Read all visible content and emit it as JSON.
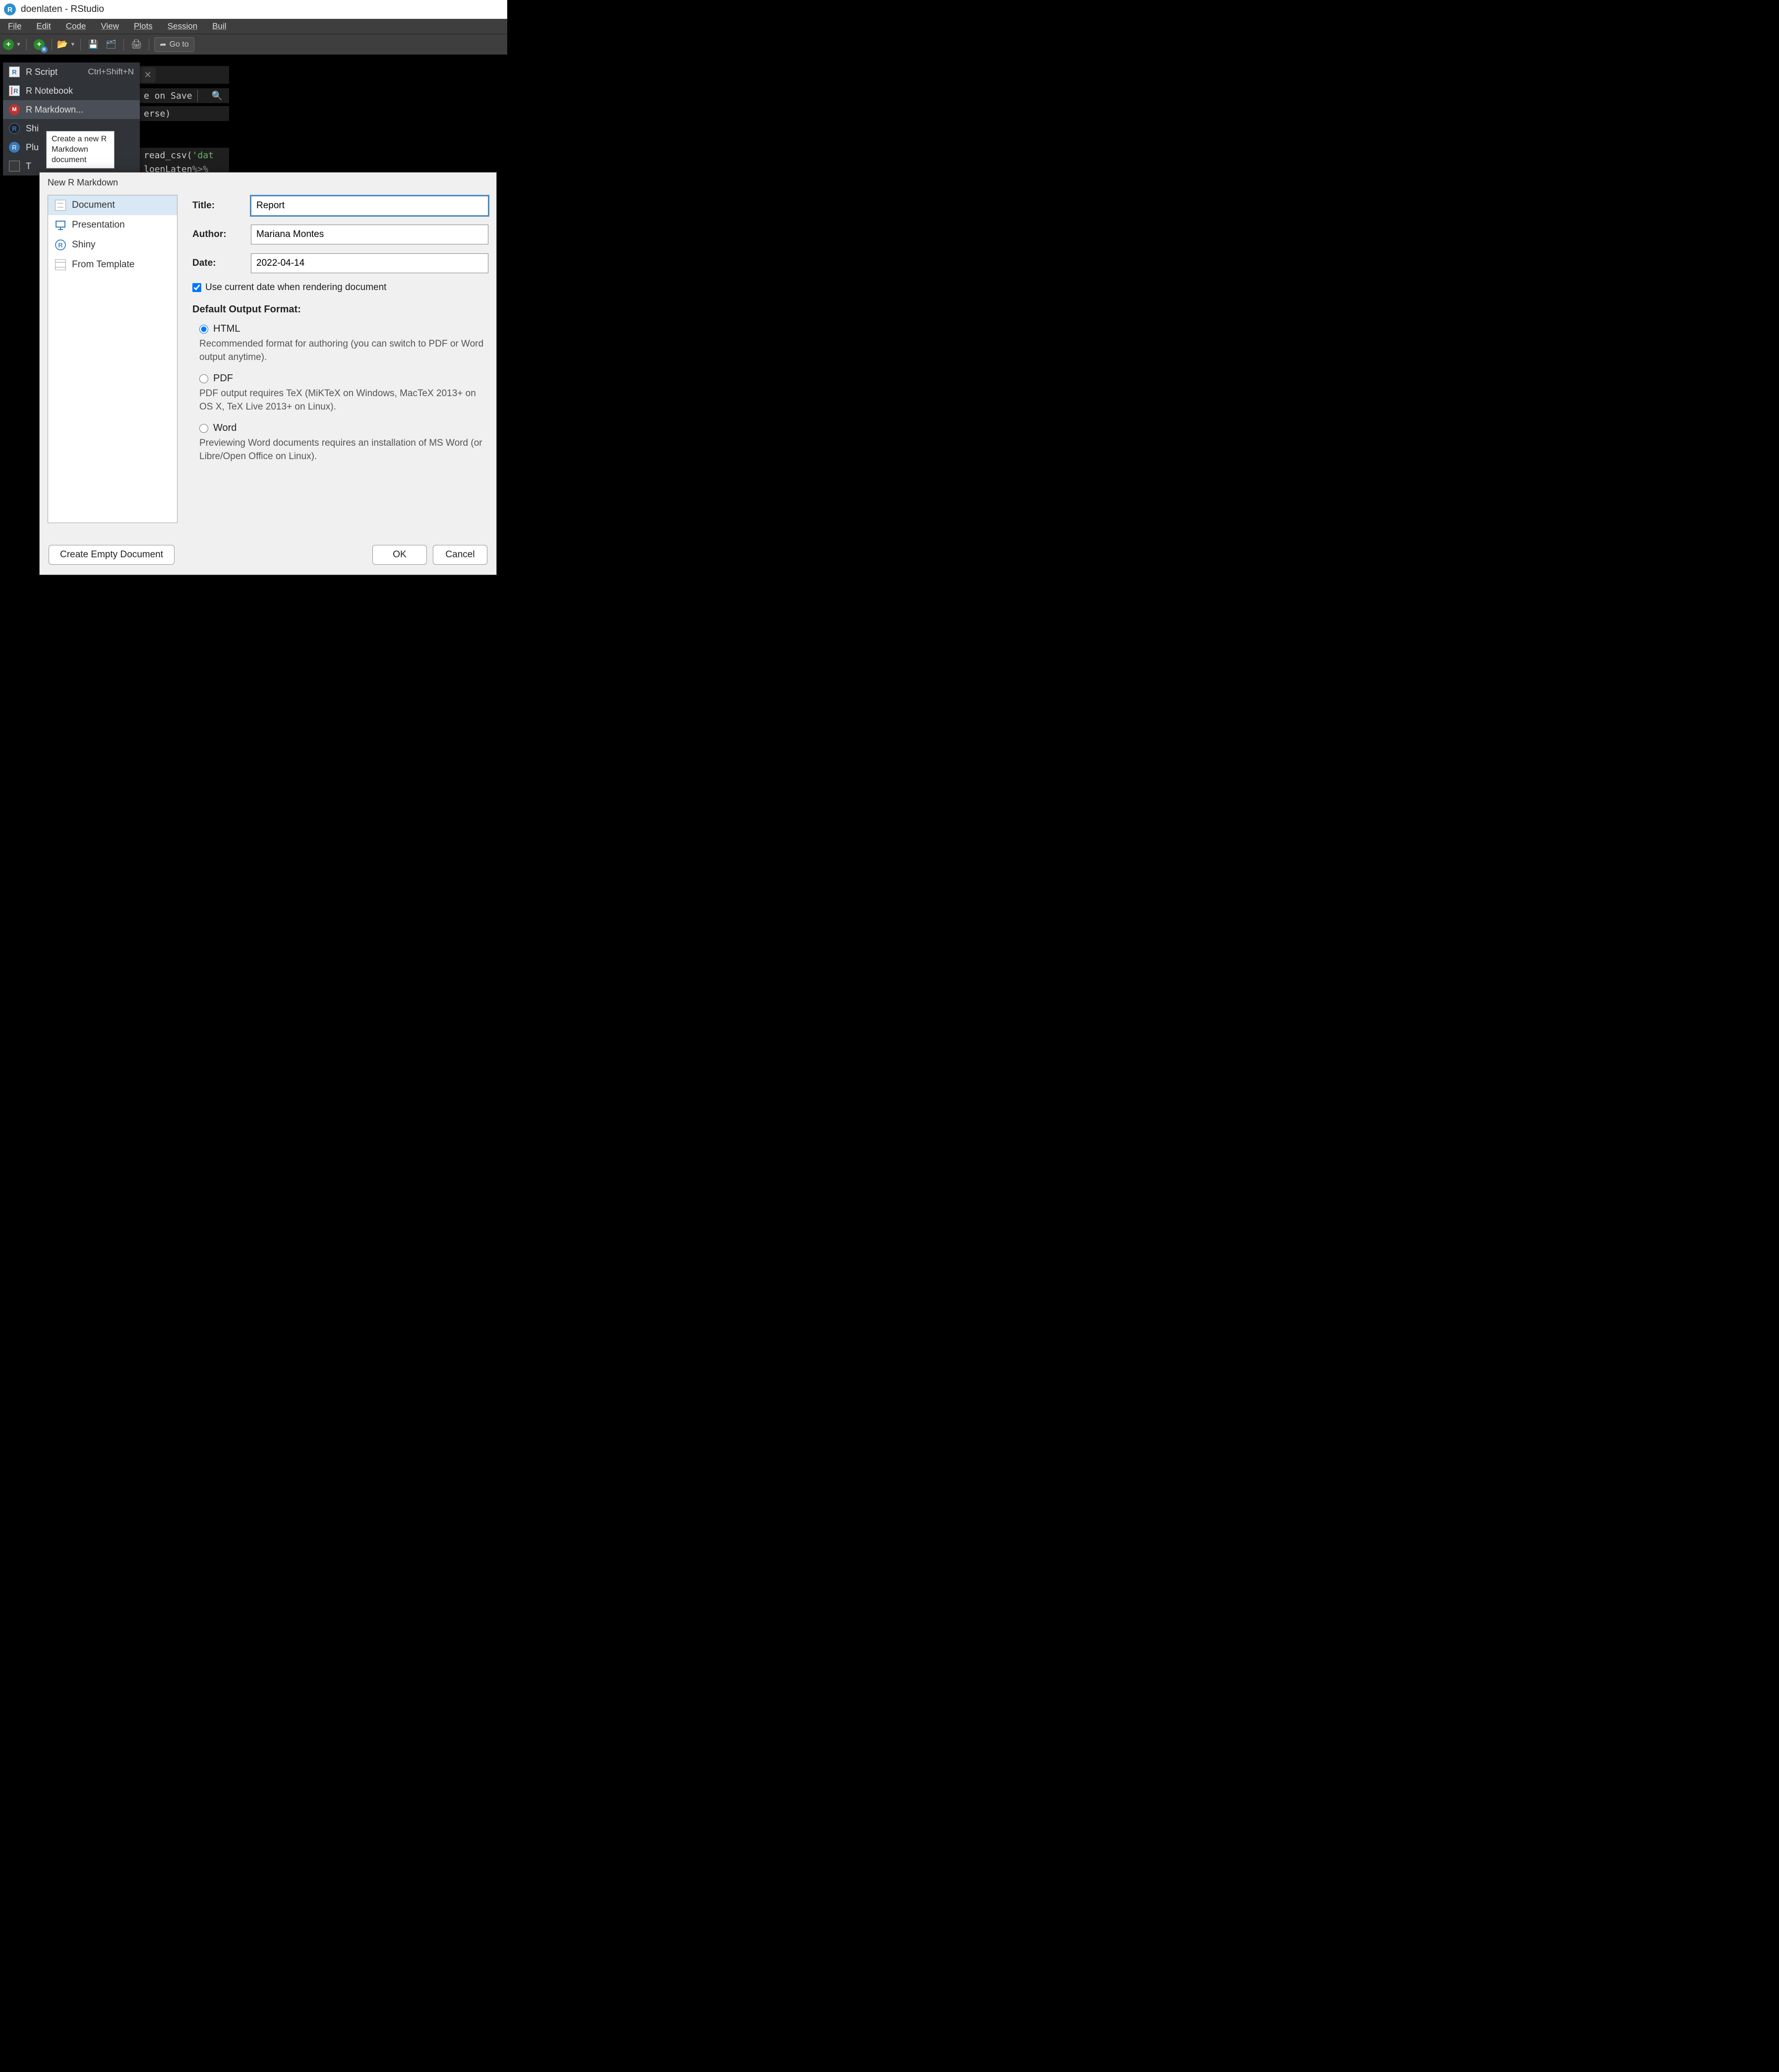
{
  "titlebar": {
    "text": "doenlaten - RStudio",
    "icon_letter": "R"
  },
  "menubar": {
    "items": [
      "File",
      "Edit",
      "Code",
      "View",
      "Plots",
      "Session",
      "Buil"
    ]
  },
  "toolbar": {
    "goto_label": "Go to"
  },
  "dropdown_newfile": {
    "items": [
      {
        "label": "R Script",
        "shortcut": "Ctrl+Shift+N",
        "icon": "page-r"
      },
      {
        "label": "R Notebook",
        "shortcut": "",
        "icon": "notebook"
      },
      {
        "label": "R Markdown...",
        "shortcut": "",
        "icon": "markdown",
        "hovered": true
      },
      {
        "label": "Shi",
        "shortcut": "",
        "icon": "shiny-r"
      },
      {
        "label": "Plu",
        "shortcut": "",
        "icon": "plumber"
      },
      {
        "label": "T",
        "shortcut": "",
        "icon": "page-plain"
      }
    ]
  },
  "tooltip": {
    "lines": [
      "Create a new R",
      "Markdown",
      "document"
    ]
  },
  "editor": {
    "on_save_fragment": "e on Save",
    "code_frag1": "erse)",
    "code_frag2_fn": "read_csv(",
    "code_frag2_str": "'dat",
    "code_frag3a": "loenLaten",
    "code_frag3b": " %>%"
  },
  "dialog": {
    "title": "New R Markdown",
    "categories": [
      {
        "label": "Document",
        "icon": "page",
        "selected": true
      },
      {
        "label": "Presentation",
        "icon": "presentation"
      },
      {
        "label": "Shiny",
        "icon": "shiny"
      },
      {
        "label": "From Template",
        "icon": "template"
      }
    ],
    "fields": {
      "title_label": "Title:",
      "title_value": "Report",
      "author_label": "Author:",
      "author_value": "Mariana Montes",
      "date_label": "Date:",
      "date_value": "2022-04-14",
      "use_current_date_label": "Use current date when rendering document",
      "use_current_date_checked": true
    },
    "output_section_title": "Default Output Format:",
    "output_options": [
      {
        "label": "HTML",
        "checked": true,
        "desc": "Recommended format for authoring (you can switch to PDF or Word output anytime)."
      },
      {
        "label": "PDF",
        "checked": false,
        "desc": "PDF output requires TeX (MiKTeX on Windows, MacTeX 2013+ on OS X, TeX Live 2013+ on Linux)."
      },
      {
        "label": "Word",
        "checked": false,
        "desc": "Previewing Word documents requires an installation of MS Word (or Libre/Open Office on Linux)."
      }
    ],
    "buttons": {
      "create_empty": "Create Empty Document",
      "ok": "OK",
      "cancel": "Cancel"
    }
  }
}
